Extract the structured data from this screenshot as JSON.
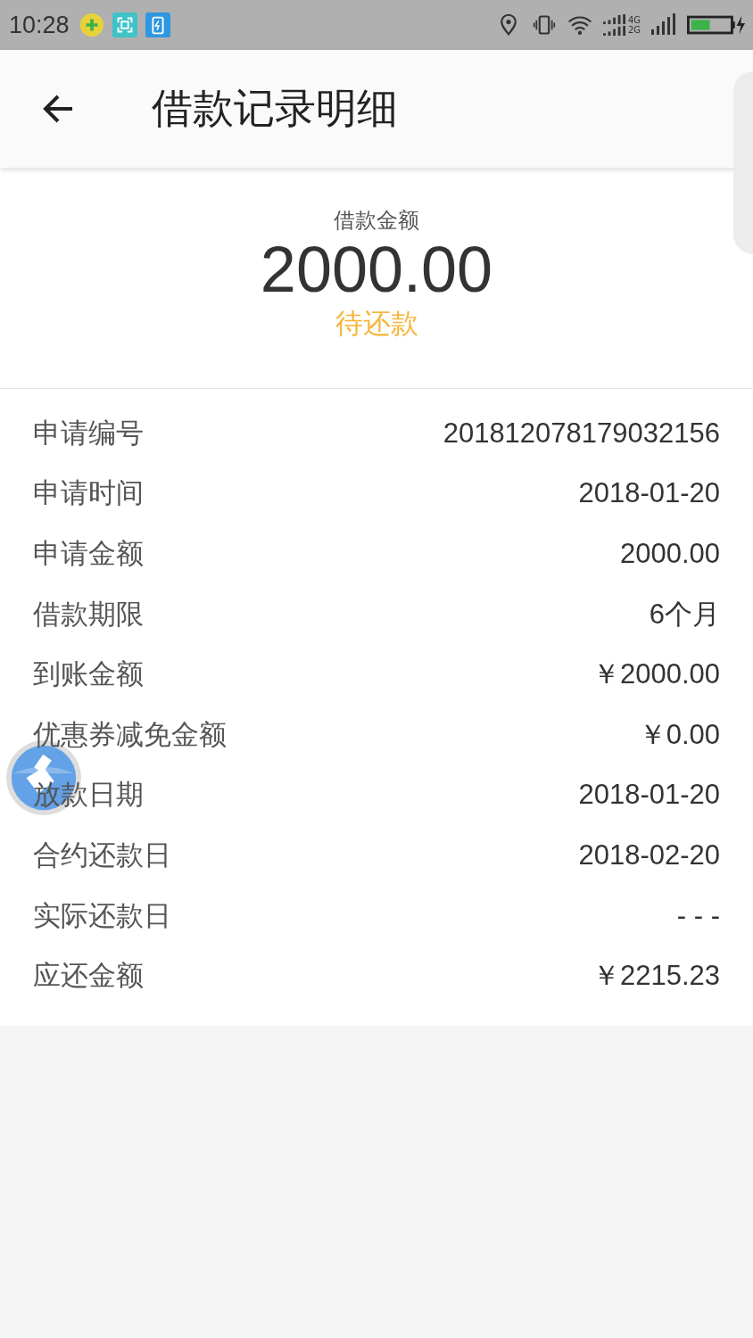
{
  "status_bar": {
    "time": "10:28",
    "network_top": "4G",
    "network_bottom": "2G"
  },
  "header": {
    "title": "借款记录明细"
  },
  "summary": {
    "label": "借款金额",
    "amount": "2000.00",
    "status": "待还款"
  },
  "details": [
    {
      "label": "申请编号",
      "value": "201812078179032156"
    },
    {
      "label": "申请时间",
      "value": "2018-01-20"
    },
    {
      "label": "申请金额",
      "value": "2000.00"
    },
    {
      "label": "借款期限",
      "value": "6个月"
    },
    {
      "label": "到账金额",
      "value": "￥2000.00"
    },
    {
      "label": "优惠券减免金额",
      "value": "￥0.00"
    },
    {
      "label": "放款日期",
      "value": "2018-01-20"
    },
    {
      "label": "合约还款日",
      "value": "2018-02-20"
    },
    {
      "label": "实际还款日",
      "value": "- - -"
    },
    {
      "label": "应还金额",
      "value": "￥2215.23"
    }
  ]
}
